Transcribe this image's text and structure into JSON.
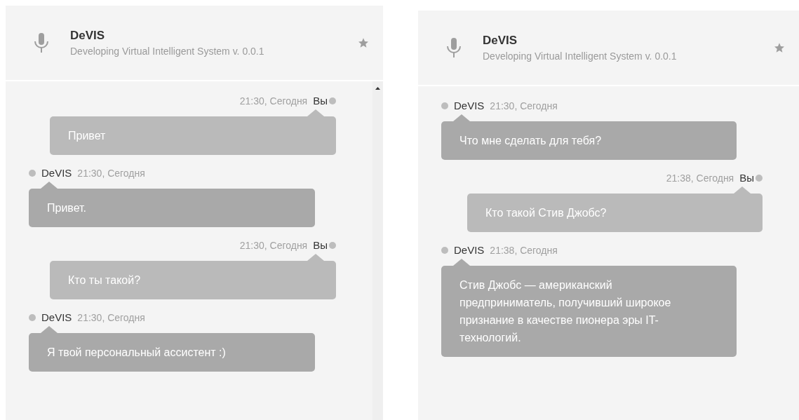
{
  "panels": [
    {
      "header": {
        "title": "DeVIS",
        "subtitle": "Developing Virtual Intelligent System v. 0.0.1"
      },
      "scrollable": true,
      "messages": [
        {
          "kind": "user",
          "sender": "Вы",
          "time": "21:30, Сегодня",
          "text": "Привет"
        },
        {
          "kind": "bot",
          "sender": "DeVIS",
          "time": "21:30, Сегодня",
          "text": "Привет."
        },
        {
          "kind": "user",
          "sender": "Вы",
          "time": "21:30, Сегодня",
          "text": "Кто ты такой?"
        },
        {
          "kind": "bot",
          "sender": "DeVIS",
          "time": "21:30, Сегодня",
          "text": "Я твой персональный ассистент :)"
        }
      ]
    },
    {
      "header": {
        "title": "DeVIS",
        "subtitle": "Developing Virtual Intelligent System v. 0.0.1"
      },
      "scrollable": false,
      "messages": [
        {
          "kind": "bot",
          "sender": "DeVIS",
          "time": "21:30, Сегодня",
          "text": "Что мне сделать для тебя?"
        },
        {
          "kind": "user",
          "sender": "Вы",
          "time": "21:38, Сегодня",
          "text": "Кто такой Стив Джобс?"
        },
        {
          "kind": "bot",
          "sender": "DeVIS",
          "time": "21:38, Сегодня",
          "text": "Стив Джобс — американский предприниматель, получивший широкое признание в качестве пионера эры IT-технологий."
        }
      ]
    }
  ]
}
